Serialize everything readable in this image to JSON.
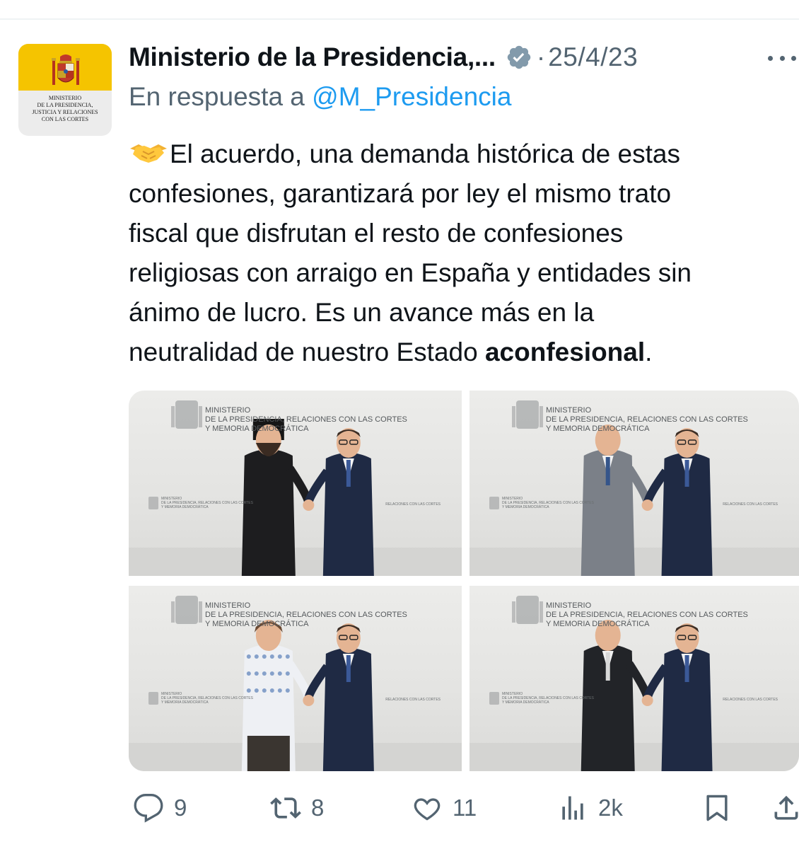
{
  "tweet": {
    "author": {
      "name": "Ministerio de la Presidencia,...",
      "avatar_label_lines": [
        "MINISTERIO",
        "DE LA PRESIDENCIA,",
        "JUSTICIA Y RELACIONES",
        "CON LAS CORTES"
      ],
      "avatar_color": "#f5c400",
      "verified_icon": "verified-badge-icon"
    },
    "date": "25/4/23",
    "separator": "·",
    "reply_prefix": "En respuesta a ",
    "reply_handle": "@M_Presidencia",
    "text_lines": [
      "El acuerdo, una demanda histórica de estas",
      "confesiones, garantizará por ley el mismo trato",
      "fiscal que disfrutan el resto de confesiones",
      "religiosas con arraigo en España y entidades sin",
      "ánimo de lucro. Es un avance más en la"
    ],
    "last_line_prefix": "neutralidad de nuestro Estado ",
    "last_line_bold": "aconfesional",
    "last_line_suffix": ".",
    "leading_emoji": "handshake-emoji",
    "photos": [
      {
        "backdrop_lines": [
          "MINISTERIO",
          "DE LA PRESIDENCIA, RELACIONES CON LAS CORTES",
          "Y MEMORIA DEMOCRÁTICA"
        ],
        "small_lines": [
          "MINISTERIO",
          "DE LA PRESIDENCIA, RELACIONES CON LAS CORTES",
          "Y MEMORIA DEMOCRÁTICA"
        ],
        "small_right": "RELACIONES CON LAS CORTES"
      },
      {
        "backdrop_lines": [
          "MINISTERIO",
          "DE LA PRESIDENCIA, RELACIONES CON LAS CORTES",
          "Y MEMORIA DEMOCRÁTICA"
        ],
        "small_lines": [
          "MINISTERIO",
          "DE LA PRESIDENCIA, RELACIONES CON LAS CORTES",
          "Y MEMORIA DEMOCRÁTICA"
        ],
        "small_right": "RELACIONES CON LAS CORTES"
      },
      {
        "backdrop_lines": [
          "MINISTERIO",
          "DE LA PRESIDENCIA, RELACIONES CON LAS CORTES",
          "Y MEMORIA DEMOCRÁTICA"
        ],
        "small_lines": [
          "MINISTERIO",
          "DE LA PRESIDENCIA, RELACIONES CON LAS CORTES",
          "Y MEMORIA DEMOCRÁTICA"
        ],
        "small_right": "RELACIONES CON LAS CORTES"
      },
      {
        "backdrop_lines": [
          "MINISTERIO",
          "DE LA PRESIDENCIA, RELACIONES CON LAS CORTES",
          "Y MEMORIA DEMOCRÁTICA"
        ],
        "small_lines": [
          "MINISTERIO",
          "DE LA PRESIDENCIA, RELACIONES CON LAS CORTES",
          "Y MEMORIA DEMOCRÁTICA"
        ],
        "small_right": "RELACIONES CON LAS CORTES"
      }
    ],
    "stats": {
      "replies": "9",
      "retweets": "8",
      "likes": "11",
      "views": "2k"
    },
    "colors": {
      "accent": "#1d9bf0",
      "secondary_text": "#536471",
      "primary_text": "#0f1419"
    }
  }
}
